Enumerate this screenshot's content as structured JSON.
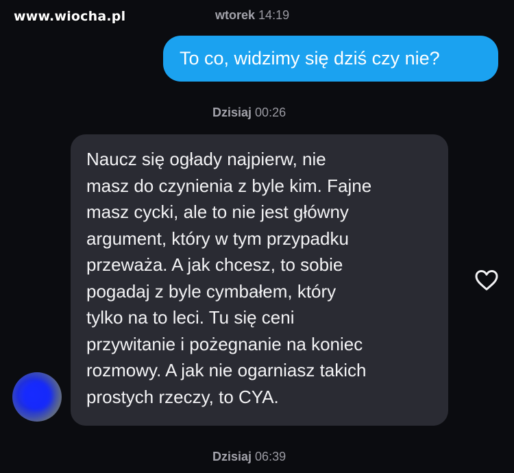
{
  "watermark": "www.wiocha.pl",
  "timestamps": [
    {
      "day": "wtorek",
      "time": "14:19"
    },
    {
      "day": "Dzisiaj",
      "time": "00:26"
    },
    {
      "day": "Dzisiaj",
      "time": "06:39"
    }
  ],
  "messages": {
    "outgoing": "To co, widzimy się dziś czy nie?",
    "incoming": "Naucz się ogłady najpierw, nie\nmasz do czynienia z byle kim. Fajne\nmasz cycki, ale to nie jest główny\nargument, który w tym przypadku\nprzeważa. A jak chcesz, to sobie\npogadaj z byle cymbałem, który\ntylko na to leci. Tu się ceni\nprzywitanie i pożegnanie na koniec\nrozmowy. A jak nie ogarniasz takich\nprostych rzeczy, to CYA."
  },
  "icons": {
    "like": "heart-outline-icon",
    "avatar": "blurred-avatar"
  },
  "colors": {
    "background": "#0b0c10",
    "outgoing_bubble": "#1ba2f0",
    "incoming_bubble": "#2a2b33",
    "timestamp": "#9a9aa2"
  }
}
